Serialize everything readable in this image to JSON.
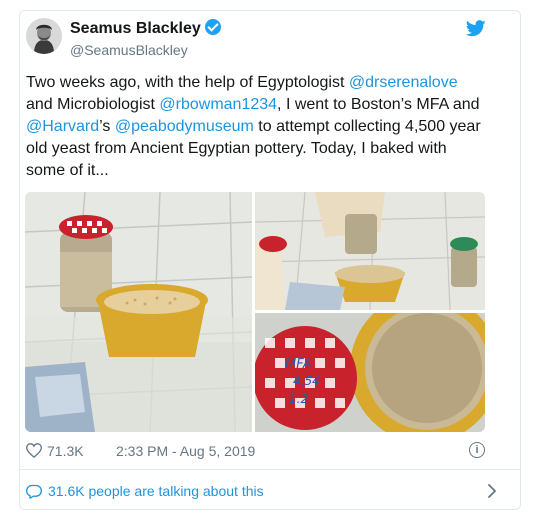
{
  "user": {
    "name": "Seamus Blackley",
    "handle": "@SeamusBlackley",
    "verified": true
  },
  "tweet": {
    "segments": [
      {
        "text": "Two weeks ago, with the help of Egyptologist ",
        "type": "text"
      },
      {
        "text": "@drserenalove",
        "type": "mention"
      },
      {
        "text": " and Microbiologist ",
        "type": "text"
      },
      {
        "text": "@rbowman1234",
        "type": "mention"
      },
      {
        "text": ", I went to Boston’s MFA and ",
        "type": "text"
      },
      {
        "text": "@Harvard",
        "type": "mention"
      },
      {
        "text": "’s ",
        "type": "text"
      },
      {
        "text": "@peabodymuseum",
        "type": "mention"
      },
      {
        "text": " to attempt collecting 4,500 year old yeast from Ancient Egyptian pottery. Today, I baked with some of it...",
        "type": "text"
      }
    ]
  },
  "media": {
    "photos": [
      {
        "label": "jar-and-bowl-photo"
      },
      {
        "label": "pouring-yeast-photo"
      },
      {
        "label": "jar-lid-closeup-photo",
        "lid_text": "MFA 4,54 1.2"
      }
    ]
  },
  "meta": {
    "likes": "71.3K",
    "timestamp": "2:33 PM - Aug 5, 2019",
    "info_glyph": "i"
  },
  "footer": {
    "text": "31.6K people are talking about this"
  },
  "colors": {
    "link": "#1b95e0",
    "verified": "#1da1f2",
    "muted": "#657786",
    "border": "#e1e8ed"
  }
}
